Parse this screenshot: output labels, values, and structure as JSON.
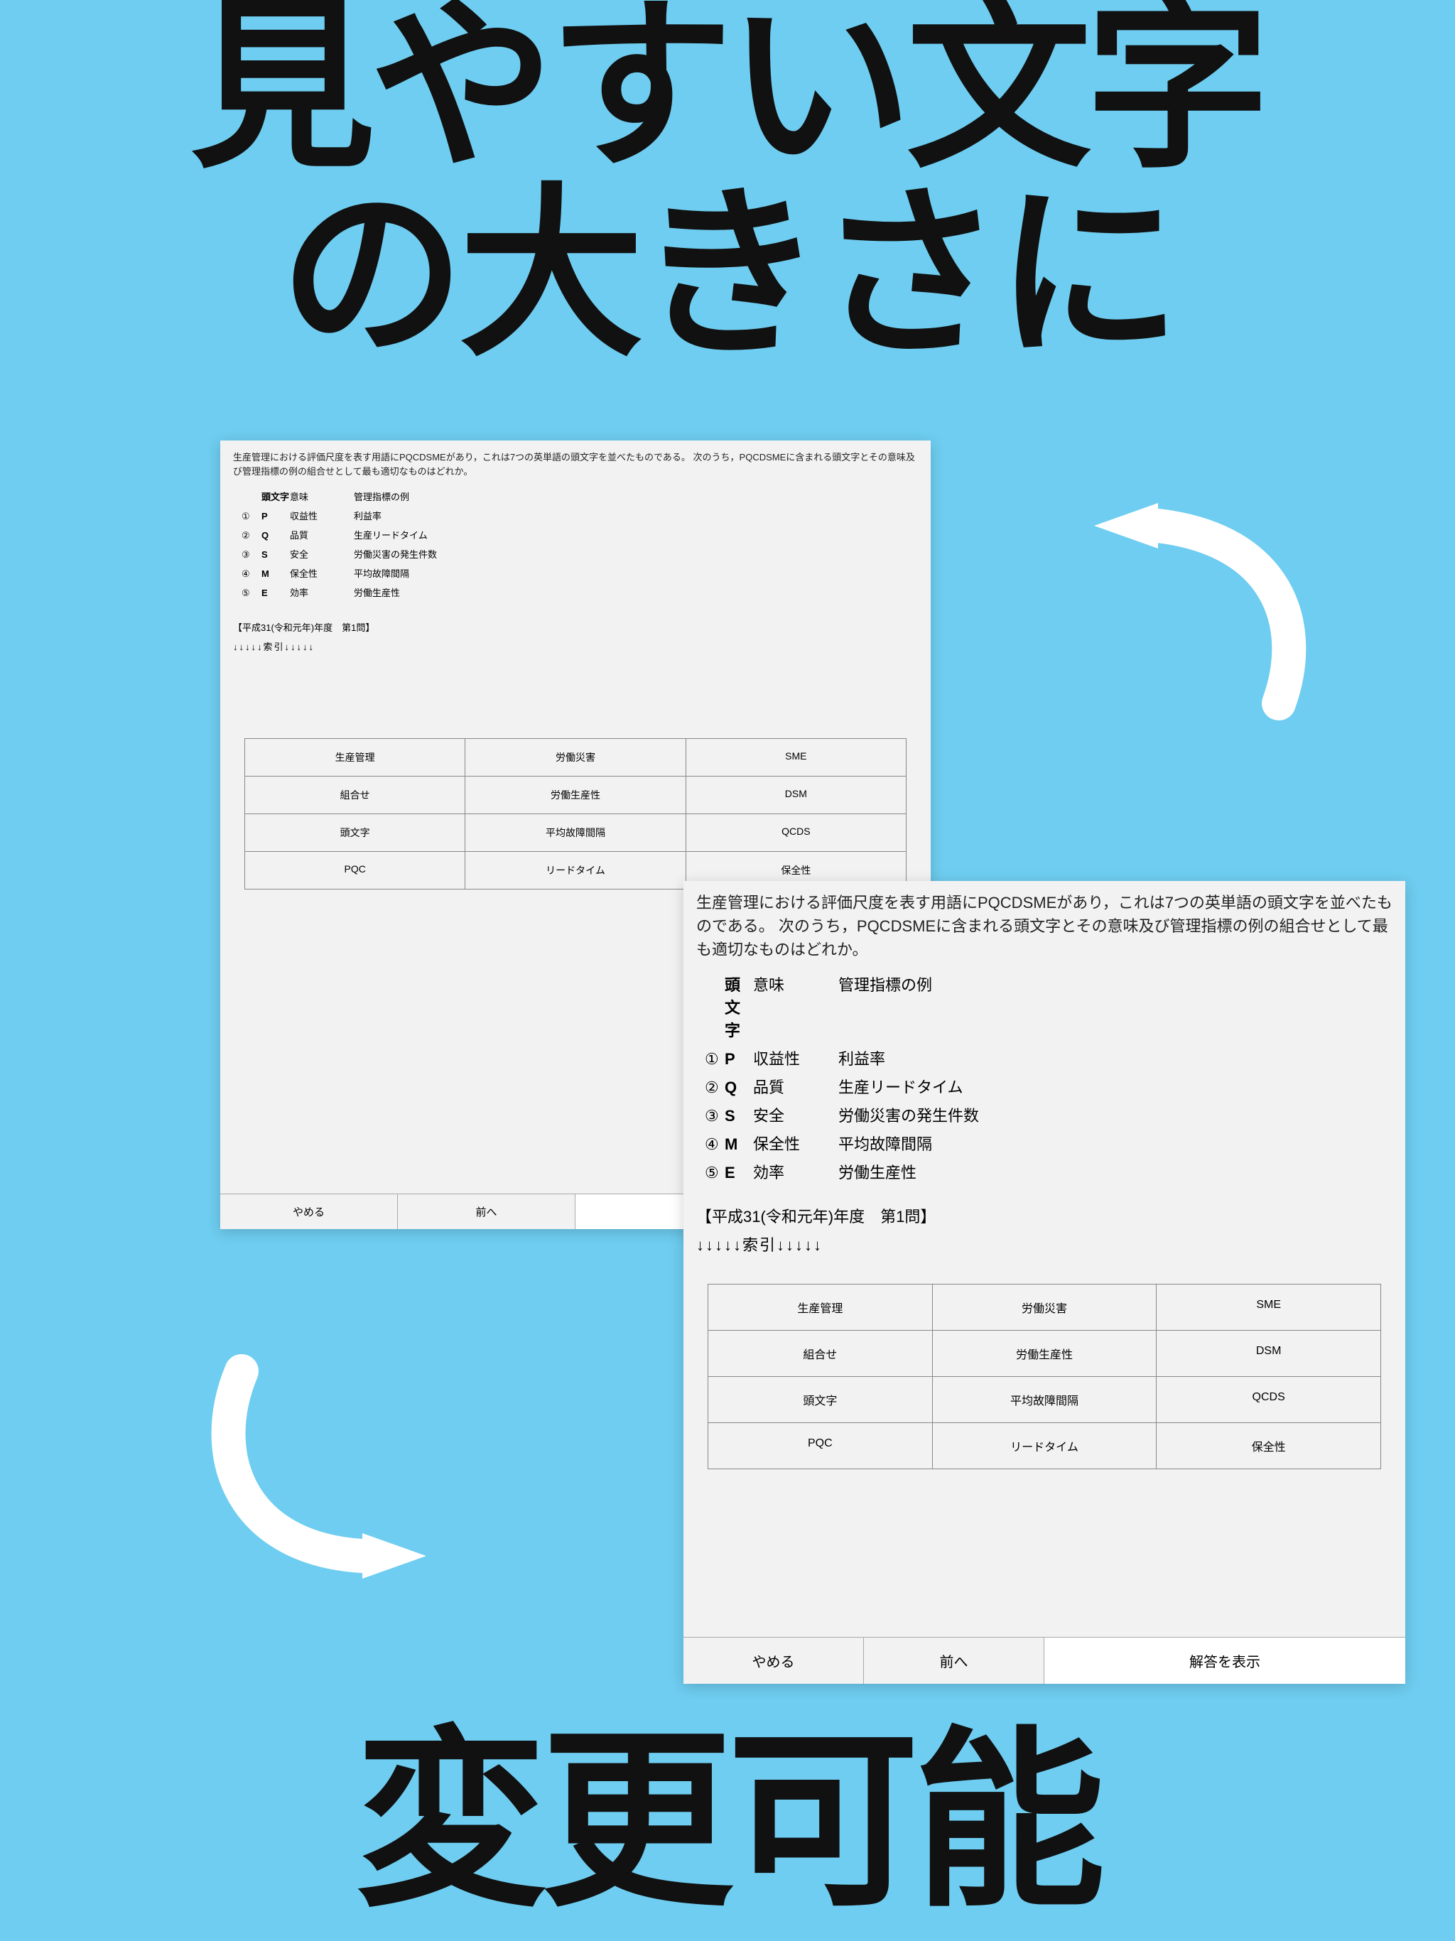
{
  "headline": {
    "line1": "見やすい文字",
    "line2": "の大きさに",
    "bottom": "変更可能"
  },
  "question": {
    "text": "生産管理における評価尺度を表す用語にPQCDSMEがあり，これは7つの英単語の頭文字を並べたものである。 次のうち，PQCDSMEに含まれる頭文字とその意味及び管理指標の例の組合せとして最も適切なものはどれか。",
    "defHeader": {
      "col1": "頭文字",
      "col2": "意味",
      "col3": "管理指標の例"
    },
    "defs": [
      {
        "n": "①",
        "letter": "P",
        "mean": "収益性",
        "ex": "利益率"
      },
      {
        "n": "②",
        "letter": "Q",
        "mean": "品質",
        "ex": "生産リードタイム"
      },
      {
        "n": "③",
        "letter": "S",
        "mean": "安全",
        "ex": "労働災害の発生件数"
      },
      {
        "n": "④",
        "letter": "M",
        "mean": "保全性",
        "ex": "平均故障間隔"
      },
      {
        "n": "⑤",
        "letter": "E",
        "mean": "効率",
        "ex": "労働生産性"
      }
    ],
    "meta": "【平成31(令和元年)年度　第1問】",
    "index": "↓↓↓↓↓索引↓↓↓↓↓"
  },
  "gridSmall": [
    [
      "生産管理",
      "労働災害",
      "SME"
    ],
    [
      "組合せ",
      "労働生産性",
      "DSM"
    ],
    [
      "頭文字",
      "平均故障間隔",
      "QCDS"
    ],
    [
      "PQC",
      "リードタイム",
      "保全性"
    ]
  ],
  "gridLarge": [
    [
      "生産管理",
      "労働災害",
      "SME"
    ],
    [
      "組合せ",
      "労働生産性",
      "DSM"
    ],
    [
      "頭文字",
      "平均故障間隔",
      "QCDS"
    ],
    [
      "PQC",
      "リードタイム",
      "保全性"
    ]
  ],
  "footer": {
    "quit": "やめる",
    "prev": "前へ",
    "show": "解答を表示"
  }
}
